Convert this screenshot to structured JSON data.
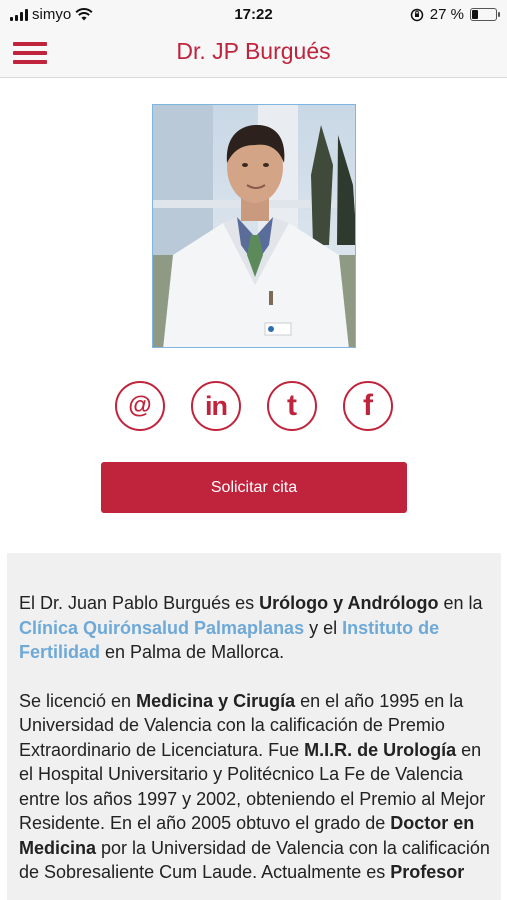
{
  "status_bar": {
    "carrier": "simyo",
    "time": "17:22",
    "battery_percent": "27 %",
    "battery_level": 0.27
  },
  "nav": {
    "title": "Dr. JP Burgués",
    "menu_icon": "hamburger-menu-icon"
  },
  "social": [
    {
      "name": "email",
      "icon": "at-icon",
      "glyph": "@"
    },
    {
      "name": "linkedin",
      "icon": "linkedin-icon",
      "glyph": "in"
    },
    {
      "name": "twitter",
      "icon": "twitter-icon",
      "glyph": "t"
    },
    {
      "name": "facebook",
      "icon": "facebook-icon",
      "glyph": "f"
    }
  ],
  "cta_label": "Solicitar cita",
  "bio": {
    "p1": {
      "t1": "El Dr. Juan Pablo Burgués es ",
      "b1": "Urólogo y Andrólogo",
      "t2": " en la ",
      "link1": "Clínica Quirónsalud Palmaplanas",
      "t3": " y el ",
      "link2": "Instituto de Fertilidad",
      "t4": " en Palma de Mallorca."
    },
    "p2": {
      "t1": "Se licenció en ",
      "b1": "Medicina y Cirugía",
      "t2": " en el año 1995 en la Universidad de Valencia con la calificación de Premio Extraordinario de Licenciatura. Fue ",
      "b2": "M.I.R. de Urología",
      "t3": " en el Hospital Universitario y Politécnico La Fe de Valencia entre los años 1997 y 2002, obteniendo el Premio al Mejor Residente. En el año 2005 obtuvo el grado de ",
      "b3": "Doctor en Medicina",
      "t4": " por la Universidad de Valencia con la calificación de Sobresaliente Cum Laude. Actualmente es ",
      "b4": "Profesor"
    }
  },
  "colors": {
    "accent": "#c0243d",
    "link": "#6ea9d7",
    "bio_background": "#f0f0f0"
  }
}
